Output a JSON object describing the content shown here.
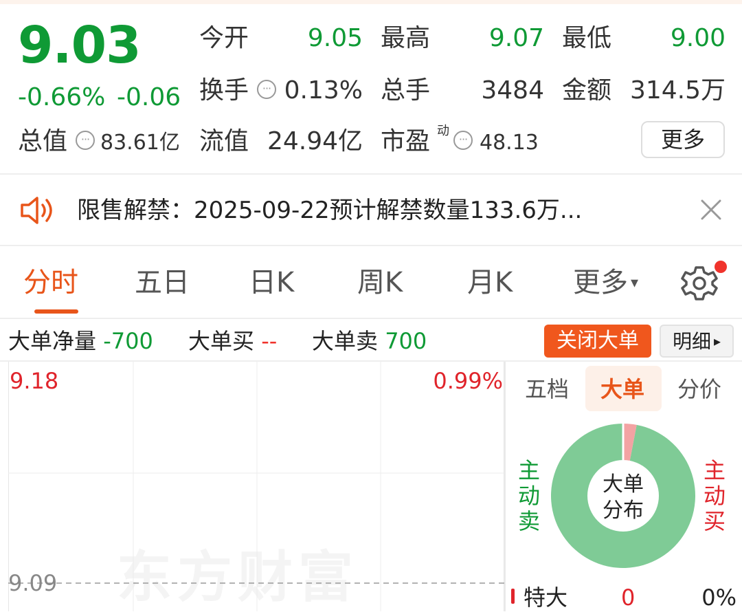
{
  "quote": {
    "price": "9.03",
    "change_pct": "-0.66%",
    "change_abs": "-0.06",
    "open_label": "今开",
    "open": "9.05",
    "high_label": "最高",
    "high": "9.07",
    "low_label": "最低",
    "low": "9.00",
    "turnover_label": "换手",
    "turnover": "0.13%",
    "volume_label": "总手",
    "volume": "3484",
    "amount_label": "金额",
    "amount": "314.5万",
    "mcap_label": "总值",
    "mcap": "83.61亿",
    "float_label": "流值",
    "float_cap": "24.94亿",
    "pe_label": "市盈",
    "pe_sup": "动",
    "pe": "48.13",
    "more_button": "更多",
    "info_icon_glyph": "···"
  },
  "notice": {
    "text": "限售解禁：2025-09-22预计解禁数量133.6万..."
  },
  "tabs": [
    {
      "label": "分时",
      "active": true
    },
    {
      "label": "五日"
    },
    {
      "label": "日K"
    },
    {
      "label": "周K"
    },
    {
      "label": "月K"
    },
    {
      "label": "更多"
    }
  ],
  "tabs_more_arrow": "▾",
  "big_order": {
    "net_label": "大单净量",
    "net_value": "-700",
    "buy_label": "大单买",
    "buy_value": "--",
    "sell_label": "大单卖",
    "sell_value": "700",
    "close_button": "关闭大单",
    "detail_button": "明细",
    "detail_arrow": "▸"
  },
  "chart": {
    "y_top_price": "9.18",
    "y_top_pct": "0.99%",
    "y_mid_price": "9.09",
    "watermark": "东方财富"
  },
  "panel": {
    "subtabs": [
      "五档",
      "大单",
      "分价"
    ],
    "active_subtab": "大单",
    "left_vertical": "主动卖",
    "right_vertical": "主动买",
    "donut_center_line1": "大单",
    "donut_center_line2": "分布",
    "sell_share": 0.97,
    "row_label": "特大",
    "row_count": "0",
    "row_pct": "0%"
  },
  "colors": {
    "down_green": "#0f9a35",
    "up_red": "#e0242b",
    "accent_orange": "#e8551a",
    "donut_green": "#7fcb96"
  }
}
